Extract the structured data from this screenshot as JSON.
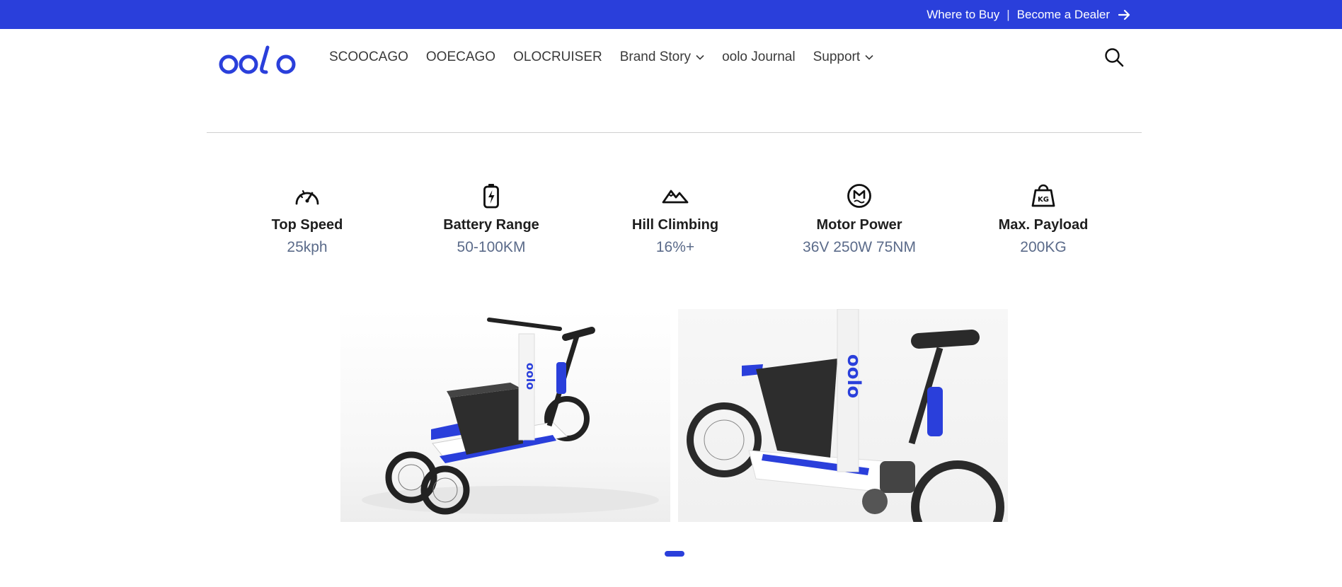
{
  "topbar": {
    "where_to_buy": "Where to Buy",
    "separator": "|",
    "become_dealer": "Become a Dealer",
    "background": "#2a3fdb"
  },
  "brand": {
    "logo_text": "oolo",
    "color": "#2a3fdb"
  },
  "nav": {
    "items": [
      {
        "label": "SCOOCAGO",
        "has_dropdown": false
      },
      {
        "label": "OOECAGO",
        "has_dropdown": false
      },
      {
        "label": "OLOCRUISER",
        "has_dropdown": false
      },
      {
        "label": "Brand Story",
        "has_dropdown": true
      },
      {
        "label": "oolo Journal",
        "has_dropdown": false
      },
      {
        "label": "Support",
        "has_dropdown": true
      }
    ],
    "search_icon": "search-icon"
  },
  "specs": [
    {
      "icon": "speedometer-icon",
      "label": "Top Speed",
      "value": "25kph"
    },
    {
      "icon": "battery-icon",
      "label": "Battery Range",
      "value": "50-100KM"
    },
    {
      "icon": "mountain-icon",
      "label": "Hill Climbing",
      "value": "16%+"
    },
    {
      "icon": "motor-icon",
      "label": "Motor Power",
      "value": "36V 250W 75NM"
    },
    {
      "icon": "weight-icon",
      "label": "Max. Payload",
      "value": "200KG"
    }
  ],
  "gallery": {
    "slides": [
      {
        "content": "cargo-trike-image"
      },
      {
        "content": "cargo-trike-closeup-image"
      }
    ],
    "pagination": {
      "active_index": 0,
      "count": 1
    }
  },
  "colors": {
    "accent": "#2a3fdb",
    "spec_value": "#5b6b8a"
  }
}
